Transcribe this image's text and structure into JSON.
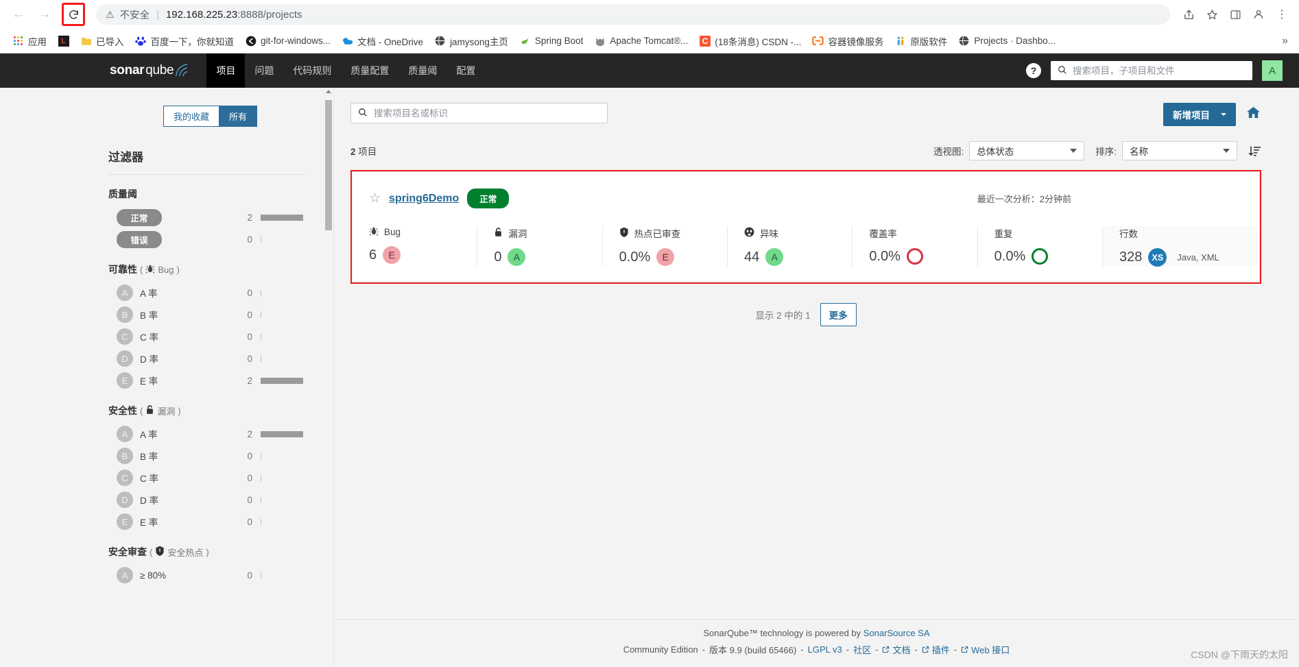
{
  "browser": {
    "back_icon": "back-arrow",
    "forward_icon": "forward-arrow",
    "reload_icon": "reload",
    "security_label": "不安全",
    "url_host": "192.168.225.23",
    "url_port": ":8888",
    "url_path": "/projects",
    "bookmarks": [
      {
        "label": "应用",
        "icon": "apps-grid",
        "color": "#4285f4"
      },
      {
        "label": "",
        "icon": "leetcode-l",
        "color": "#e03c31"
      },
      {
        "label": "已导入",
        "icon": "folder",
        "color": "#f7c948"
      },
      {
        "label": "百度一下，你就知道",
        "icon": "baidu-paw",
        "color": "#2932e1"
      },
      {
        "label": "git-for-windows...",
        "icon": "git-logo",
        "color": "#1b1b1b"
      },
      {
        "label": "文档 - OneDrive",
        "icon": "onedrive-cloud",
        "color": "#0f6cbd"
      },
      {
        "label": "jamysong主页",
        "icon": "globe",
        "color": "#4a4a4a"
      },
      {
        "label": "Spring Boot",
        "icon": "spring-leaf",
        "color": "#6db33f"
      },
      {
        "label": "Apache Tomcat®...",
        "icon": "tomcat-cat",
        "color": "#7a7a7a"
      },
      {
        "label": "(18条消息) CSDN -...",
        "icon": "csdn-c",
        "color": "#fc5531"
      },
      {
        "label": "容器镜像服务",
        "icon": "aliyun-acr",
        "color": "#ff6a00"
      },
      {
        "label": "原版软件",
        "icon": "people",
        "color": "#f5a623"
      },
      {
        "label": "Projects · Dashbo...",
        "icon": "globe",
        "color": "#4a4a4a"
      }
    ],
    "overflow_label": "»"
  },
  "sq_header": {
    "logo_sonar": "sonar",
    "logo_qube": "qube",
    "nav": [
      {
        "label": "项目",
        "active": true
      },
      {
        "label": "问题",
        "active": false
      },
      {
        "label": "代码规则",
        "active": false
      },
      {
        "label": "质量配置",
        "active": false
      },
      {
        "label": "质量阈",
        "active": false
      },
      {
        "label": "配置",
        "active": false
      }
    ],
    "help_label": "?",
    "search_placeholder": "搜索项目，子项目和文件",
    "search_value": "",
    "avatar_letter": "A"
  },
  "sidebar": {
    "segmented": [
      {
        "label": "我的收藏",
        "active": false
      },
      {
        "label": "所有",
        "active": true
      }
    ],
    "title": "过滤器",
    "facets": [
      {
        "title": "质量阈",
        "sub": "",
        "sub_icon": "",
        "type": "pill",
        "rows": [
          {
            "label": "正常",
            "count": "2",
            "bar": 62
          },
          {
            "label": "错误",
            "count": "0",
            "bar": 0
          }
        ]
      },
      {
        "title": "可靠性",
        "sub": "Bug",
        "sub_icon": "bug-icon",
        "type": "rating",
        "rows": [
          {
            "rating": "A",
            "label": "A 率",
            "count": "0",
            "bar": 0
          },
          {
            "rating": "B",
            "label": "B 率",
            "count": "0",
            "bar": 0
          },
          {
            "rating": "C",
            "label": "C 率",
            "count": "0",
            "bar": 0
          },
          {
            "rating": "D",
            "label": "D 率",
            "count": "0",
            "bar": 0
          },
          {
            "rating": "E",
            "label": "E 率",
            "count": "2",
            "bar": 62
          }
        ]
      },
      {
        "title": "安全性",
        "sub": "漏洞",
        "sub_icon": "lock-icon",
        "type": "rating",
        "rows": [
          {
            "rating": "A",
            "label": "A 率",
            "count": "2",
            "bar": 62
          },
          {
            "rating": "B",
            "label": "B 率",
            "count": "0",
            "bar": 0
          },
          {
            "rating": "C",
            "label": "C 率",
            "count": "0",
            "bar": 0
          },
          {
            "rating": "D",
            "label": "D 率",
            "count": "0",
            "bar": 0
          },
          {
            "rating": "E",
            "label": "E 率",
            "count": "0",
            "bar": 0
          }
        ]
      },
      {
        "title": "安全审查",
        "sub": "安全热点",
        "sub_icon": "shield-icon",
        "type": "rating",
        "rows": [
          {
            "rating": "A",
            "label": "≥ 80%",
            "count": "0",
            "bar": 0
          }
        ]
      }
    ]
  },
  "main": {
    "search_placeholder": "搜索项目名或标识",
    "search_value": "",
    "add_project_label": "新增项目",
    "home_icon": "home-icon",
    "project_count_num": "2",
    "project_count_unit": "项目",
    "perspective_label": "透视图:",
    "perspective_value": "总体状态",
    "sort_label": "排序:",
    "sort_value": "名称",
    "sort_direction_icon": "sort-descending-icon",
    "project": {
      "star_icon": "star-outline-icon",
      "name": "spring6Demo",
      "quality_gate": "正常",
      "last_analysis": "最近一次分析：2分钟前",
      "metrics": [
        {
          "label": "Bug",
          "icon": "bug-icon",
          "value": "6",
          "rating": "E",
          "rating_kind": "e"
        },
        {
          "label": "漏洞",
          "icon": "lock-icon",
          "value": "0",
          "rating": "A",
          "rating_kind": "a"
        },
        {
          "label": "热点已审查",
          "icon": "shield-icon",
          "value": "0.0%",
          "rating": "E",
          "rating_kind": "e"
        },
        {
          "label": "异味",
          "icon": "smell-icon",
          "value": "44",
          "rating": "A",
          "rating_kind": "a"
        }
      ],
      "coverage": {
        "label": "覆盖率",
        "value": "0.0%",
        "ring": "red"
      },
      "duplication": {
        "label": "重复",
        "value": "0.0%",
        "ring": "green"
      },
      "lines": {
        "label": "行数",
        "value": "328",
        "size_badge": "XS",
        "languages": "Java, XML"
      }
    },
    "showing_text": "显示 2 中的 1",
    "more_label": "更多"
  },
  "footer": {
    "line1_pre": "SonarQube™ technology is powered by ",
    "line1_link": "SonarSource SA",
    "edition": "Community Edition",
    "sep": "-",
    "version": "版本 9.9 (build 65466)",
    "links": [
      {
        "label": "LGPL v3",
        "external": false
      },
      {
        "label": "社区",
        "external": false
      },
      {
        "label": "文档",
        "external": true
      },
      {
        "label": "插件",
        "external": true
      },
      {
        "label": "Web 接口",
        "external": true
      }
    ]
  },
  "watermark": "CSDN @下雨天的太阳"
}
